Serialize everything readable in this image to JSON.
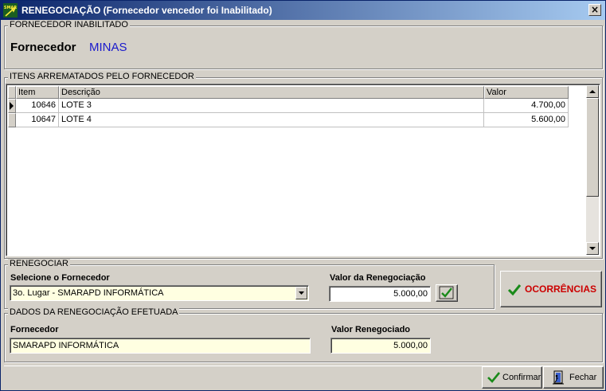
{
  "window": {
    "title": "RENEGOCIAÇÃO (Fornecedor vencedor foi Inabilitado)",
    "logo_text": "SMAR",
    "close_label": "×"
  },
  "fornecedor_inabilitado": {
    "legend": "FORNECEDOR INABILITADO",
    "label": "Fornecedor",
    "value": "MINAS"
  },
  "itens": {
    "legend": "ITENS ARREMATADOS PELO FORNECEDOR",
    "columns": [
      "Item",
      "Descrição",
      "Valor"
    ],
    "rows": [
      {
        "item": "10646",
        "descricao": "LOTE 3",
        "valor": "4.700,00"
      },
      {
        "item": "10647",
        "descricao": "LOTE 4",
        "valor": "5.600,00"
      }
    ]
  },
  "renegociar": {
    "legend": "RENEGOCIAR",
    "selecione_label": "Selecione o Fornecedor",
    "selecione_value": "3o. Lugar - SMARAPD INFORMÁTICA",
    "valor_label": "Valor da Renegociação",
    "valor_value": "5.000,00"
  },
  "ocorrencias_label": "OCORRÊNCIAS",
  "dados": {
    "legend": "DADOS DA RENEGOCIAÇÃO EFETUADA",
    "fornecedor_label": "Fornecedor",
    "fornecedor_value": "SMARAPD INFORMÁTICA",
    "valor_label": "Valor Renegociado",
    "valor_value": "5.000,00"
  },
  "footer": {
    "confirmar_label": "Confirmar",
    "fechar_label": "Fechar"
  },
  "colors": {
    "title_start": "#0a246a",
    "title_end": "#a6caf0",
    "fornecedor_value": "#1a1acc",
    "ocorrencias_text": "#cc0000",
    "check_green": "#1a8a1a",
    "field_yellow": "#ffffe1"
  }
}
